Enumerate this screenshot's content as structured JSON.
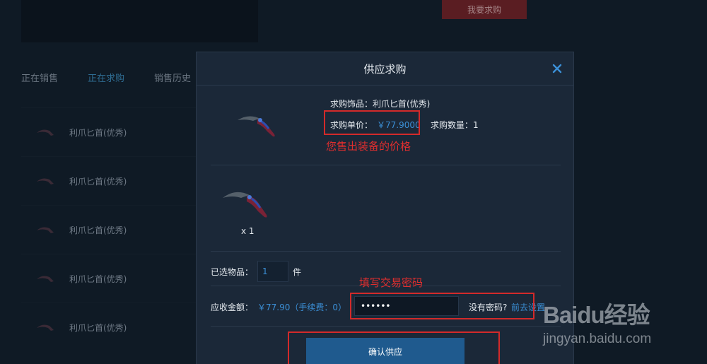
{
  "background": {
    "buy_button": "我要求购",
    "tabs": [
      {
        "label": "正在销售",
        "active": false
      },
      {
        "label": "正在求购",
        "active": true
      },
      {
        "label": "销售历史",
        "active": false
      }
    ],
    "list_items": [
      "利爪匕首(优秀)",
      "利爪匕首(优秀)",
      "利爪匕首(优秀)",
      "利爪匕首(优秀)",
      "利爪匕首(优秀)"
    ]
  },
  "modal": {
    "title": "供应求购",
    "close_icon": "close-icon",
    "item": {
      "name_label": "求购饰品：利爪匕首(优秀)",
      "price_label": "求购单价：",
      "price_value": "￥77.9000",
      "qty_label": "求购数量：1"
    },
    "annotation_price": "您售出装备的价格",
    "selected": {
      "qty": "x 1"
    },
    "count": {
      "label": "已选物品：",
      "value": "1",
      "unit": "件"
    },
    "amount": {
      "label": "应收金额：",
      "value": "￥77.90（手续费：0）",
      "password_value": "••••••",
      "no_password": "没有密码?",
      "go_set": "前去设置"
    },
    "annotation_password": "填写交易密码",
    "confirm_button": "确认供应"
  },
  "watermark": {
    "logo": "Baidu经验",
    "url": "jingyan.baidu.com"
  },
  "colors": {
    "accent_blue": "#3b8fd6",
    "annotation_red": "#d32a2a",
    "button_blue": "#1f5a8e"
  }
}
